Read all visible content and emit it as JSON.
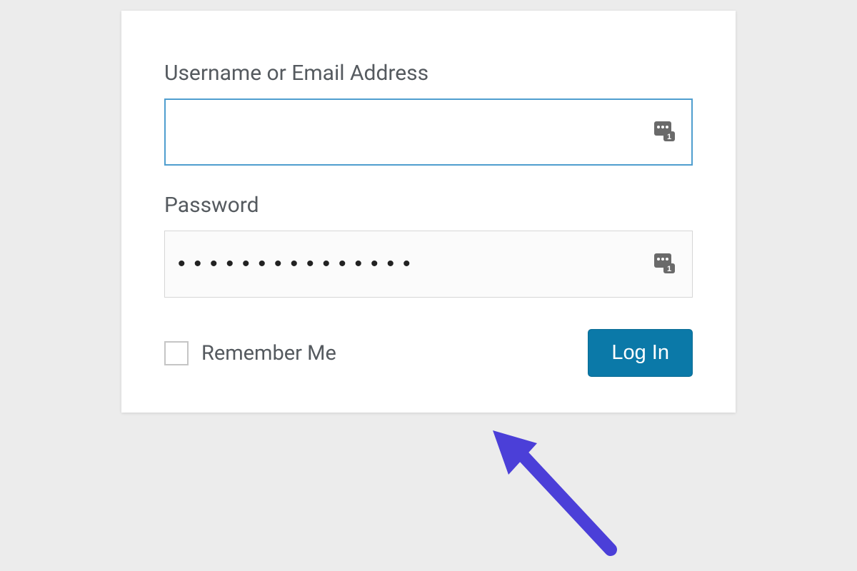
{
  "login": {
    "username_label": "Username or Email Address",
    "username_value": "",
    "password_label": "Password",
    "password_value": "•••••••••••••••",
    "remember_label": "Remember Me",
    "remember_checked": false,
    "submit_label": "Log In"
  },
  "icons": {
    "password_manager": "password-manager-autofill-icon"
  },
  "annotation": {
    "arrow_color": "#4b3fd8"
  }
}
